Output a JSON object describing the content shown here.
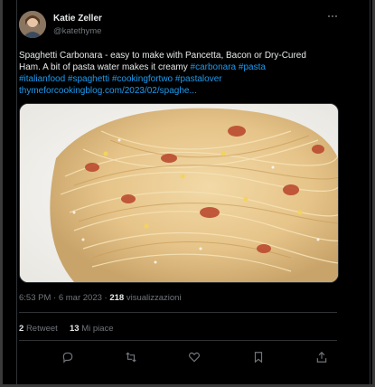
{
  "author": {
    "display_name": "Katie Zeller",
    "handle": "@katethyme"
  },
  "tweet": {
    "line1": "Spaghetti Carbonara - easy to make with Pancetta, Bacon or Dry-Cured",
    "line2_plain": "Ham. A bit of pasta water makes it creamy ",
    "line2_tags": "#carbonara #pasta",
    "line3_tags": "#italianfood #spaghetti #cookingfortwo #pastalover",
    "line4_link": "thymeforcookingblog.com/2023/02/spaghe..."
  },
  "meta": {
    "time": "6:53 PM",
    "separator1": "·",
    "date": "6 mar 2023",
    "separator2": "·",
    "views_count": "218",
    "views_label": "visualizzazioni"
  },
  "stats": {
    "retweets_count": "2",
    "retweets_label": "Retweet",
    "likes_count": "13",
    "likes_label": "Mi piace"
  },
  "icons": {
    "reply": "reply-icon",
    "retweet": "retweet-icon",
    "like": "heart-icon",
    "bookmark": "bookmark-icon",
    "share": "share-icon",
    "more": "more-icon"
  },
  "colors": {
    "background": "#000000",
    "text": "#e7e9ea",
    "secondary": "#71767b",
    "link": "#1d9bf0",
    "border": "#2f3336"
  }
}
